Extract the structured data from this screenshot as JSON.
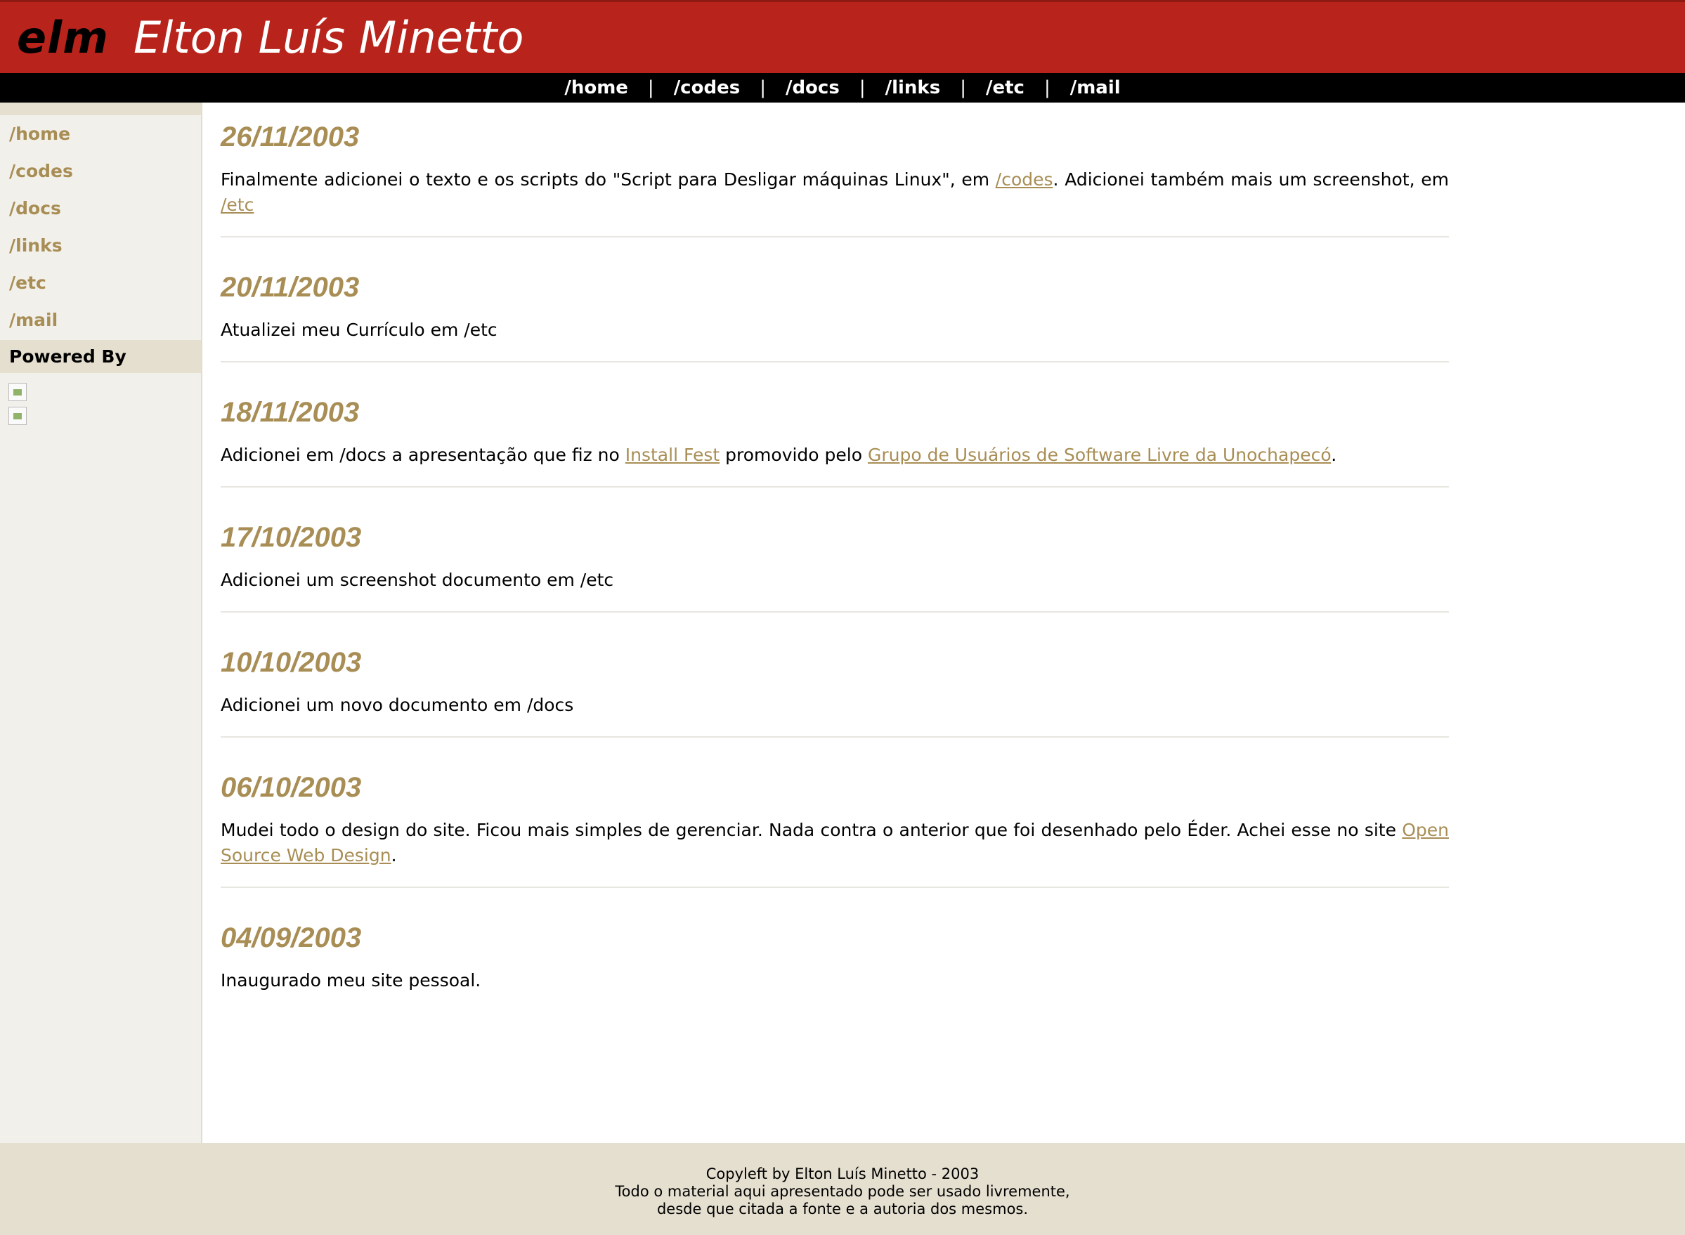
{
  "header": {
    "logo": "elm",
    "title": "Elton Luís Minetto",
    "background_color": "#b8241b"
  },
  "topnav": {
    "items": [
      "/home",
      "/codes",
      "/docs",
      "/links",
      "/etc",
      "/mail"
    ],
    "separator": "|"
  },
  "sidebar": {
    "items": [
      "/home",
      "/codes",
      "/docs",
      "/links",
      "/etc",
      "/mail"
    ],
    "powered_by_label": "Powered By",
    "link_color": "#a88e55"
  },
  "entries": [
    {
      "date": "26/11/2003",
      "parts": [
        {
          "t": "Finalmente adicionei o texto e os scripts do \"Script para Desligar máquinas Linux\", em "
        },
        {
          "t": "/codes",
          "link": true
        },
        {
          "t": ". Adicionei também mais um screenshot, em "
        },
        {
          "t": "/etc",
          "link": true
        }
      ]
    },
    {
      "date": "20/11/2003",
      "parts": [
        {
          "t": "Atualizei meu Currículo em /etc"
        }
      ]
    },
    {
      "date": "18/11/2003",
      "parts": [
        {
          "t": "Adicionei em /docs a apresentação que fiz no "
        },
        {
          "t": "Install Fest",
          "link": true
        },
        {
          "t": " promovido pelo "
        },
        {
          "t": "Grupo de Usuários de Software Livre da Unochapecó",
          "link": true
        },
        {
          "t": "."
        }
      ]
    },
    {
      "date": "17/10/2003",
      "parts": [
        {
          "t": "Adicionei um screenshot documento em /etc"
        }
      ]
    },
    {
      "date": "10/10/2003",
      "parts": [
        {
          "t": "Adicionei um novo documento em /docs"
        }
      ]
    },
    {
      "date": "06/10/2003",
      "parts": [
        {
          "t": "Mudei todo o design do site. Ficou mais simples de gerenciar. Nada contra o anterior que foi desenhado pelo Éder. Achei esse no site "
        },
        {
          "t": "Open Source Web Design",
          "link": true
        },
        {
          "t": "."
        }
      ]
    },
    {
      "date": "04/09/2003",
      "parts": [
        {
          "t": "Inaugurado meu site pessoal."
        }
      ]
    }
  ],
  "footer": {
    "line1": "Copyleft by Elton Luís Minetto - 2003",
    "line2": "Todo o material aqui apresentado pode ser usado livremente,",
    "line3": "desde que citada a fonte e a autoria dos mesmos."
  }
}
